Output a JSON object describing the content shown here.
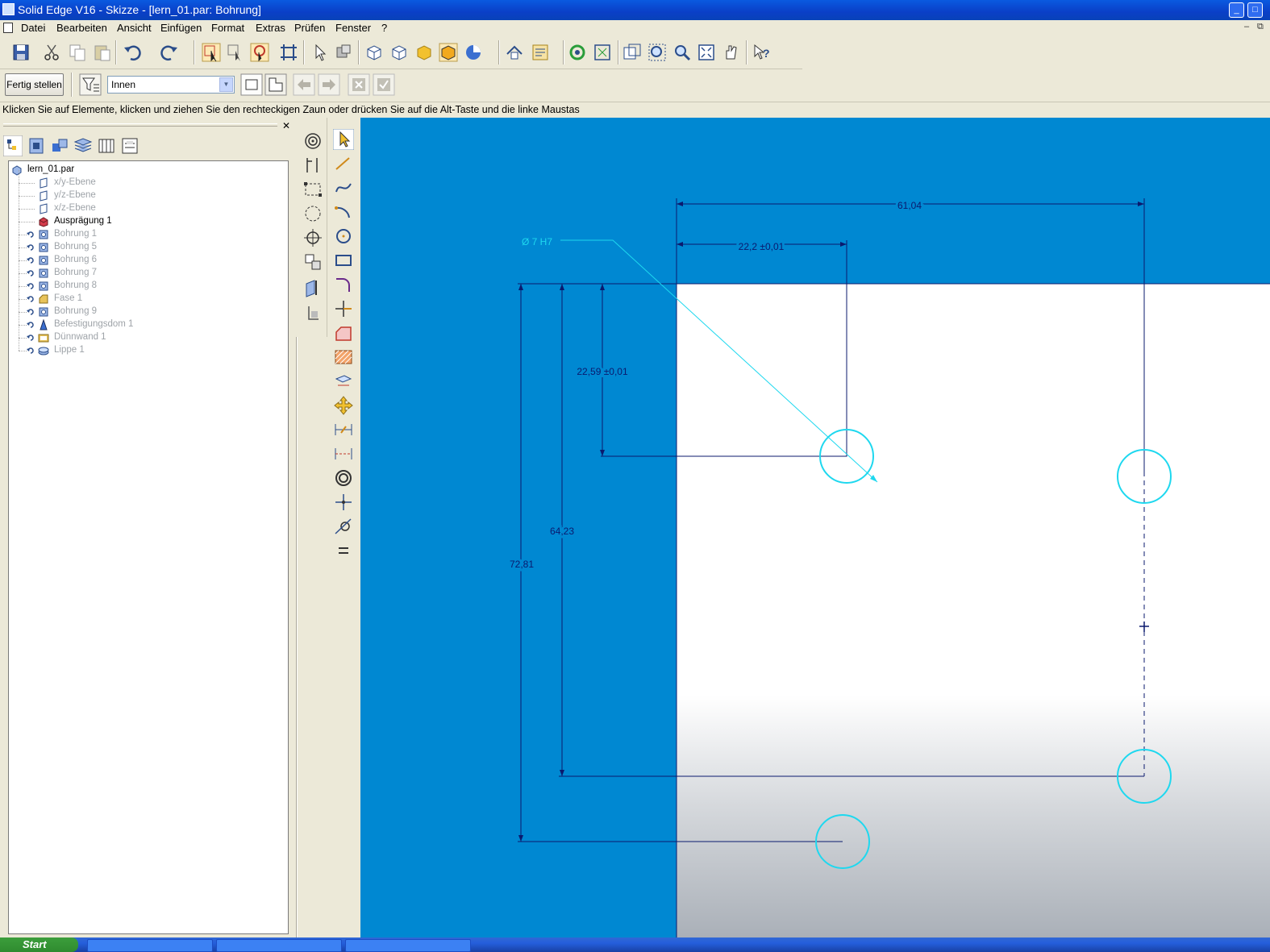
{
  "window": {
    "title": "Solid Edge V16 - Skizze - [lern_01.par: Bohrung]"
  },
  "menu": [
    "Datei",
    "Bearbeiten",
    "Ansicht",
    "Einfügen",
    "Format",
    "Extras",
    "Prüfen",
    "Fenster",
    "?"
  ],
  "ribbon": {
    "finish_label": "Fertig stellen",
    "side_select_value": "Innen"
  },
  "prompt": "Klicken Sie auf Elemente, klicken und ziehen Sie den rechteckigen Zaun oder drücken Sie auf die Alt-Taste und die linke Maustas",
  "pathfinder": {
    "root": "lern_01.par",
    "items": [
      {
        "label": "x/y-Ebene",
        "icon": "plane-icon",
        "state": "inactive"
      },
      {
        "label": "y/z-Ebene",
        "icon": "plane-icon",
        "state": "inactive"
      },
      {
        "label": "x/z-Ebene",
        "icon": "plane-icon",
        "state": "inactive"
      },
      {
        "label": "Ausprägung 1",
        "icon": "protrusion-icon",
        "state": "active"
      },
      {
        "label": "Bohrung 1",
        "icon": "hole-icon",
        "state": "rolled-back"
      },
      {
        "label": "Bohrung 5",
        "icon": "hole-icon",
        "state": "rolled-back"
      },
      {
        "label": "Bohrung 6",
        "icon": "hole-icon",
        "state": "rolled-back"
      },
      {
        "label": "Bohrung 7",
        "icon": "hole-icon",
        "state": "rolled-back"
      },
      {
        "label": "Bohrung 8",
        "icon": "hole-icon",
        "state": "rolled-back"
      },
      {
        "label": "Fase 1",
        "icon": "chamfer-icon",
        "state": "rolled-back"
      },
      {
        "label": "Bohrung 9",
        "icon": "hole-icon",
        "state": "rolled-back"
      },
      {
        "label": "Befestigungsdom 1",
        "icon": "mounting-boss-icon",
        "state": "rolled-back"
      },
      {
        "label": "Dünnwand 1",
        "icon": "thinwall-icon",
        "state": "rolled-back"
      },
      {
        "label": "Lippe 1",
        "icon": "lip-icon",
        "state": "rolled-back"
      }
    ]
  },
  "sketch": {
    "hole_callout": "Ø 7 H7",
    "dims": {
      "width_total": "61,04",
      "width_first": "22,2  ±0,01",
      "height_first": "22,59  ±0,01",
      "height_second": "64,23",
      "height_total": "72,81"
    },
    "colors": {
      "background": "#0088d2",
      "dimension": "#0b1a6e",
      "hole": "#1ed8ef",
      "face": "#ffffff"
    }
  },
  "taskbar": {
    "start_label": "Start"
  }
}
